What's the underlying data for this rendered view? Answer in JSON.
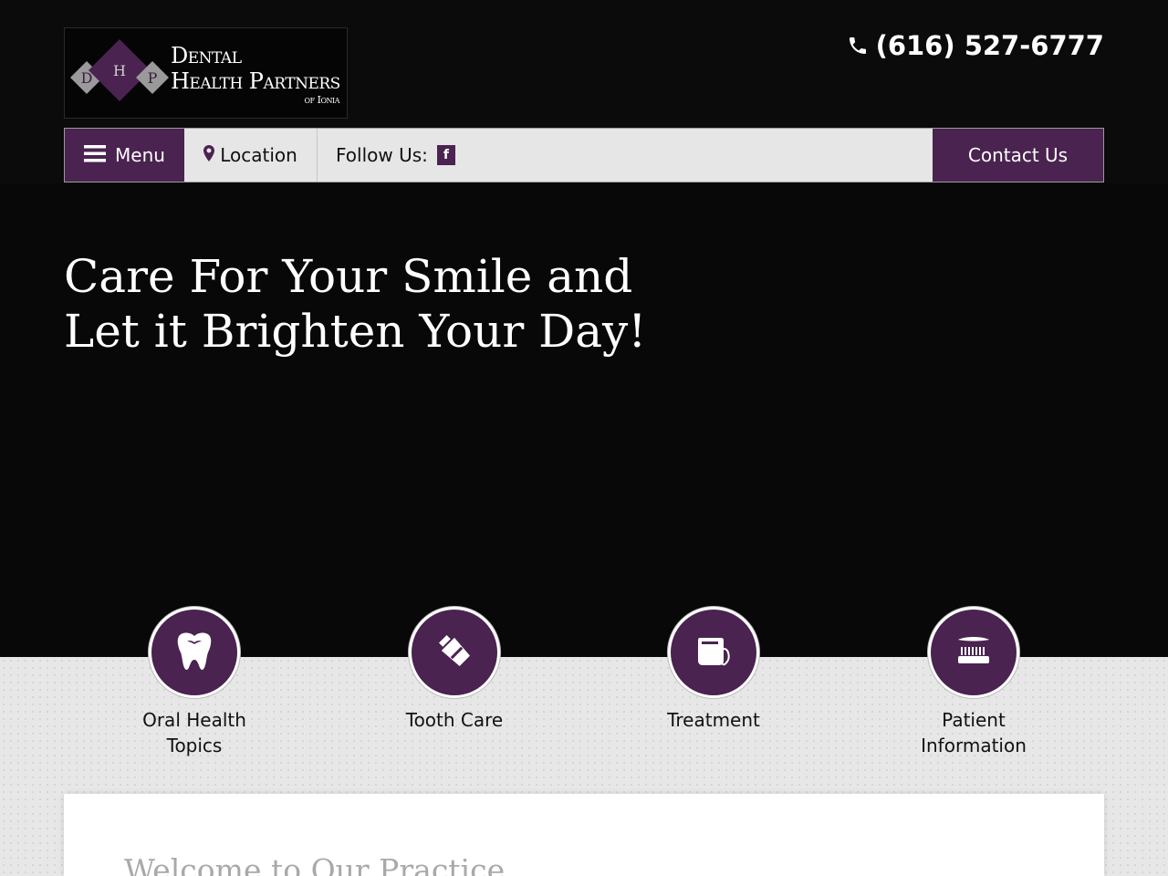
{
  "logo": {
    "monogram": [
      "D",
      "H",
      "P"
    ],
    "line1": "Dental",
    "line2": "Health Partners",
    "line3": "of Ionia"
  },
  "header": {
    "phone": "(616) 527-6777"
  },
  "nav": {
    "menu": "Menu",
    "location": "Location",
    "follow": "Follow Us:",
    "facebook": "f",
    "contact": "Contact Us"
  },
  "hero": {
    "title_line1": "Care For Your Smile and",
    "title_line2": "Let it Brighten Your Day!"
  },
  "features": [
    {
      "label_line1": "Oral Health",
      "label_line2": "Topics",
      "icon": "tooth-icon"
    },
    {
      "label_line1": "Tooth Care",
      "label_line2": "",
      "icon": "toothpaste-icon"
    },
    {
      "label_line1": "Treatment",
      "label_line2": "",
      "icon": "floss-icon"
    },
    {
      "label_line1": "Patient",
      "label_line2": "Information",
      "icon": "toothbrush-icon"
    }
  ],
  "welcome": {
    "title": "Welcome to Our Practice"
  },
  "colors": {
    "brand_purple": "#4a2350",
    "header_bg": "#0b0b0c",
    "nav_bg": "#e6e6e6"
  }
}
